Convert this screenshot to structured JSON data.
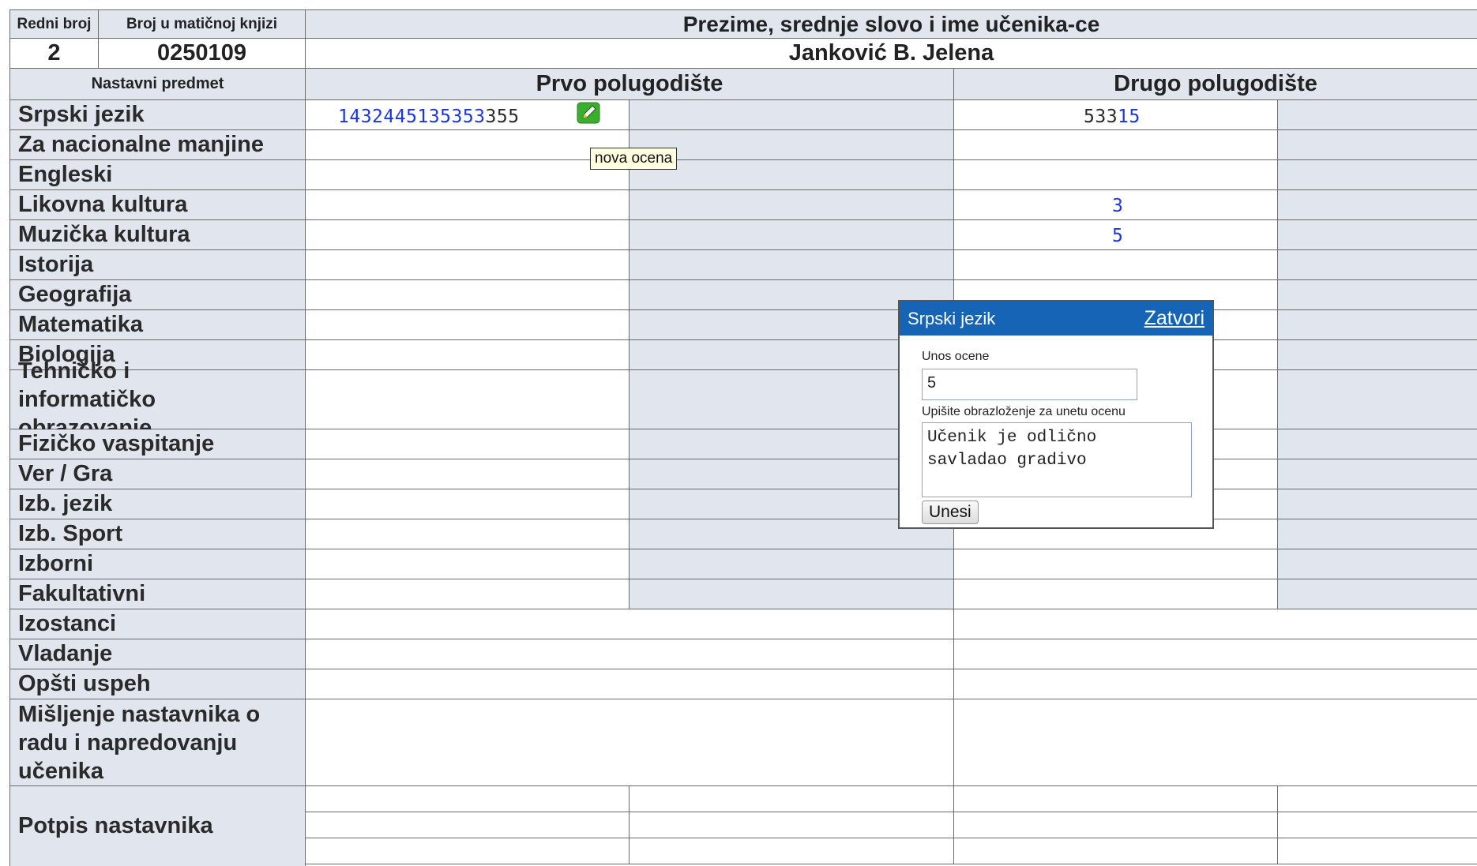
{
  "header": {
    "col_redni": "Redni broj",
    "col_broj": "Broj u matičnoj knjizi",
    "col_ime": "Prezime, srednje slovo i ime učenika-ce",
    "redni_value": "2",
    "broj_value": "0250109",
    "ime_value": "Janković B. Jelena",
    "nastavni_predmet": "Nastavni predmet",
    "prvo": "Prvo polugodište",
    "drugo": "Drugo polugodište"
  },
  "subjects": [
    {
      "name": "Srpski jezik"
    },
    {
      "name": "Za nacionalne manjine"
    },
    {
      "name": "Engleski"
    },
    {
      "name": "Likovna kultura"
    },
    {
      "name": "Muzička kultura"
    },
    {
      "name": "Istorija"
    },
    {
      "name": "Geografija"
    },
    {
      "name": "Matematika"
    },
    {
      "name": "Biologija"
    },
    {
      "name": "Tehničko i informatičko obrazovanje"
    },
    {
      "name": "Fizičko vaspitanje"
    },
    {
      "name": "Ver / Gra"
    },
    {
      "name": "Izb. jezik"
    },
    {
      "name": "Izb. Sport"
    },
    {
      "name": "Izborni"
    },
    {
      "name": "Fakultativni"
    }
  ],
  "grades": {
    "srpski_prvo_blue": "1432445135353",
    "srpski_prvo_dark": "355",
    "srpski_drugo_dark": "533",
    "srpski_drugo_blue": "15",
    "likovna_drugo": "3",
    "muzicka_drugo": "5"
  },
  "summary_rows": {
    "izostanci": "Izostanci",
    "vladanje": "Vladanje",
    "opsti_uspeh": "Opšti uspeh",
    "misljenje": "Mišljenje nastavnika o radu i napredovanju učenika",
    "potpis": "Potpis nastavnika"
  },
  "tooltip": "nova ocena",
  "dialog": {
    "title": "Srpski jezik",
    "close": "Zatvori",
    "grade_label": "Unos ocene",
    "grade_value": "5",
    "reason_label": "Upišite obrazloženje za unetu ocenu",
    "reason_value": "Učenik je odlično\nsavladao gradivo",
    "submit": "Unesi"
  },
  "icons": {
    "edit": "edit-pencil-icon"
  },
  "colors": {
    "header_bg": "#e1e5ee",
    "dialog_title_bg": "#1664b6",
    "grade_blue": "#1a35e6"
  }
}
